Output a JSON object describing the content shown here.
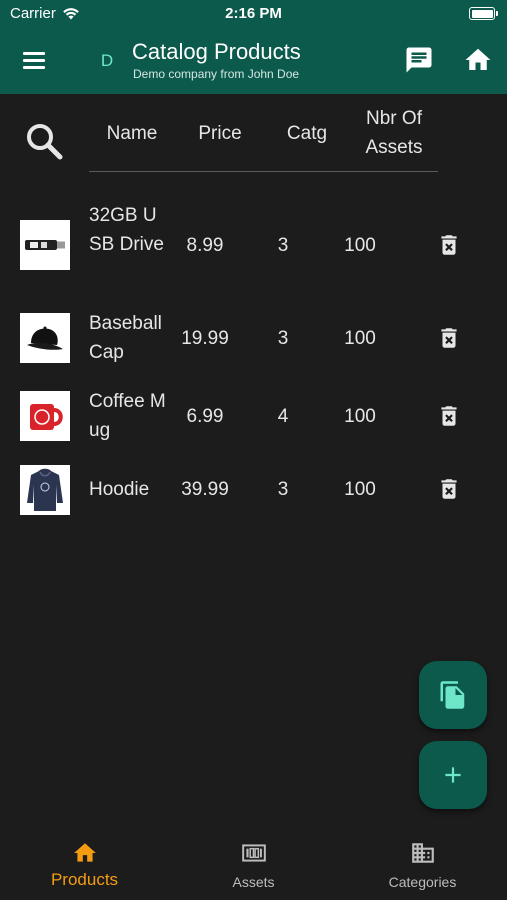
{
  "status_bar": {
    "carrier": "Carrier",
    "time": "2:16 PM"
  },
  "app_bar": {
    "avatar_letter": "D",
    "title": "Catalog Products",
    "subtitle": "Demo company from John Doe",
    "icons": [
      "menu-icon",
      "chat-icon",
      "home-icon"
    ]
  },
  "table": {
    "columns": [
      "Name",
      "Price",
      "Catg",
      "Nbr Of Assets"
    ],
    "rows": [
      {
        "name": "32GB USB Drive",
        "price": "8.99",
        "catg": "3",
        "assets": "100",
        "image": "usb-drive"
      },
      {
        "name": "Baseball Cap",
        "price": "19.99",
        "catg": "3",
        "assets": "100",
        "image": "baseball-cap"
      },
      {
        "name": "Coffee Mug",
        "price": "6.99",
        "catg": "4",
        "assets": "100",
        "image": "coffee-mug"
      },
      {
        "name": "Hoodie",
        "price": "39.99",
        "catg": "3",
        "assets": "100",
        "image": "hoodie"
      }
    ]
  },
  "fabs": [
    "copy-icon",
    "add-icon"
  ],
  "bottom_nav": {
    "items": [
      {
        "label": "Products",
        "icon": "home-icon",
        "active": true
      },
      {
        "label": "Assets",
        "icon": "assets-icon",
        "active": false
      },
      {
        "label": "Categories",
        "icon": "categories-icon",
        "active": false
      }
    ]
  },
  "colors": {
    "primary": "#0c5a4c",
    "background": "#1c1c1c",
    "accent": "#f39c12",
    "avatar_text": "#6ee7c8",
    "fab_icon": "#6ee7c8"
  }
}
